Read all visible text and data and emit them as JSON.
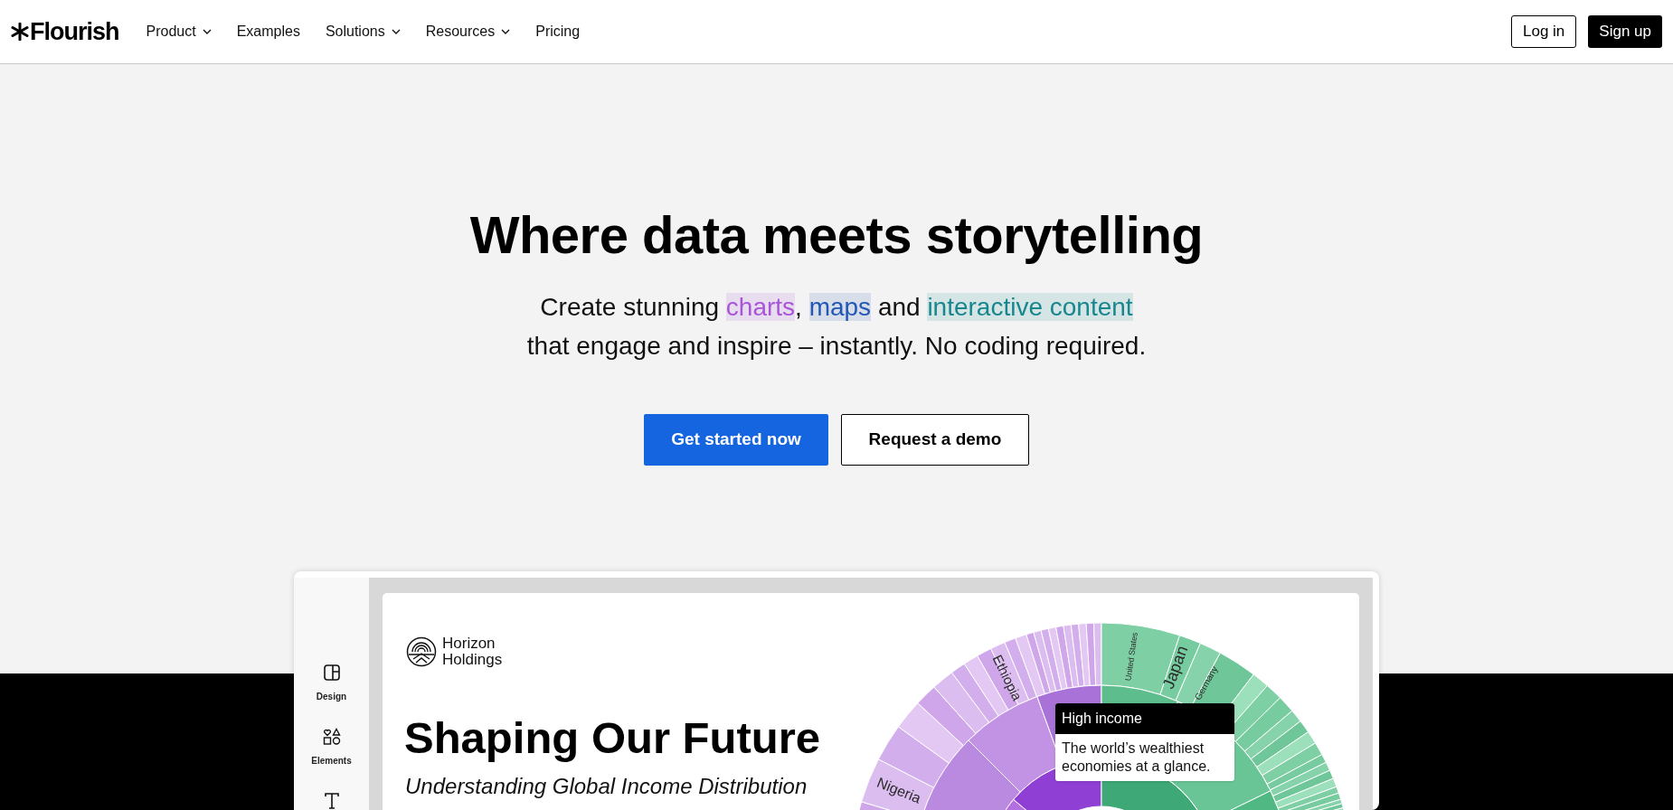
{
  "nav": {
    "logo": "Flourish",
    "items": [
      {
        "label": "Product",
        "dropdown": true
      },
      {
        "label": "Examples",
        "dropdown": false
      },
      {
        "label": "Solutions",
        "dropdown": true
      },
      {
        "label": "Resources",
        "dropdown": true
      },
      {
        "label": "Pricing",
        "dropdown": false
      }
    ],
    "login": "Log in",
    "signup": "Sign up"
  },
  "hero": {
    "title": "Where data meets storytelling",
    "subtitle_lines": [
      [
        {
          "text": "Create stunning "
        },
        {
          "text": "charts",
          "color": "#a855d8"
        },
        {
          "text": ", "
        },
        {
          "text": "maps",
          "color": "#2357b5"
        },
        {
          "text": " and "
        },
        {
          "text": "interactive content",
          "color": "#17878d"
        }
      ],
      [
        {
          "text": "that engage and inspire – instantly. No coding required."
        }
      ]
    ],
    "primary_button": "Get started now",
    "secondary_button": "Request a demo"
  },
  "preview": {
    "sidebar": [
      {
        "label": "Design",
        "kind": "design"
      },
      {
        "label": "Elements",
        "kind": "elements"
      },
      {
        "kind": "text"
      }
    ],
    "brand_lines": [
      "Horizon",
      "Holdings"
    ],
    "title": "Shaping Our Future",
    "subtitle": "Understanding Global Income Distribution",
    "sunburst_labels": [
      "Ethiopia",
      "Nigeria",
      "United States",
      "Japan",
      "Germany"
    ],
    "tooltip": {
      "title": "High income",
      "body": "The world’s wealthiest economies at a glance."
    }
  }
}
